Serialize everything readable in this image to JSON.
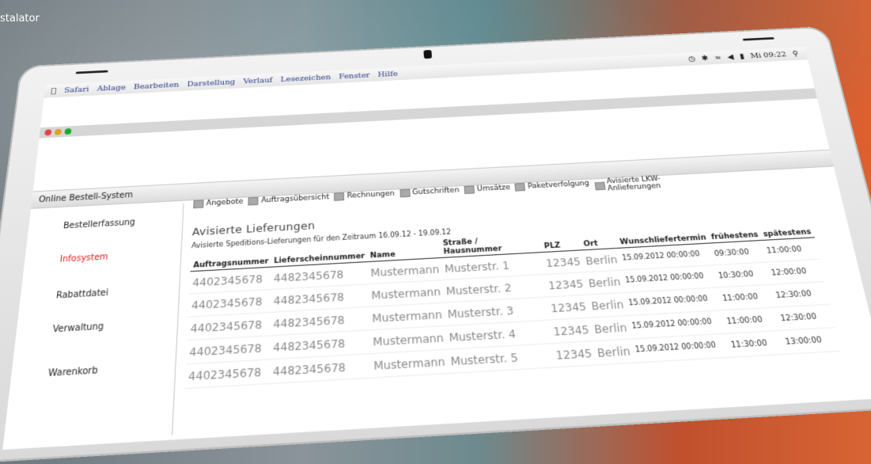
{
  "background": {
    "brand_text": "stalator"
  },
  "menubar": {
    "items": [
      "Safari",
      "Ablage",
      "Bearbeiten",
      "Darstellung",
      "Verlauf",
      "Lesezeichen",
      "Fenster",
      "Hilfe"
    ],
    "clock": "Mi 09:22"
  },
  "app": {
    "title": "Online Bestell-System"
  },
  "sidebar": {
    "items": [
      {
        "label": "Bestellerfassung",
        "active": false
      },
      {
        "label": "Infosystem",
        "active": true
      },
      {
        "label": "Rabattdatei",
        "active": false
      },
      {
        "label": "Verwaltung",
        "active": false
      },
      {
        "label": "Warenkorb",
        "active": false
      }
    ]
  },
  "tabs": [
    "Angebote",
    "Auftragsübersicht",
    "Rechnungen",
    "Gutschriften",
    "Umsätze",
    "Paketverfolgung",
    "Avisierte LKW-Anlieferungen"
  ],
  "main": {
    "heading": "Avisierte Lieferungen",
    "subtitle": "Avisierte Speditions-Lieferungen für den Zeitraum 16.09.12 - 19.09.12"
  },
  "table": {
    "headers": [
      "Auftragsnummer",
      "Lieferscheinnummer",
      "Name",
      "Straße / Hausnummer",
      "PLZ",
      "Ort",
      "Wunschliefertermin",
      "frühestens",
      "spätestens"
    ],
    "rows": [
      {
        "auftrag": "4402345678",
        "lieferschein": "4482345678",
        "name": "Mustermann",
        "strasse": "Musterstr. 1",
        "plz": "12345",
        "ort": "Berlin",
        "termin": "15.09.2012 00:00:00",
        "frueh": "09:30:00",
        "spaet": "11:00:00"
      },
      {
        "auftrag": "4402345678",
        "lieferschein": "4482345678",
        "name": "Mustermann",
        "strasse": "Musterstr. 2",
        "plz": "12345",
        "ort": "Berlin",
        "termin": "15.09.2012 00:00:00",
        "frueh": "10:30:00",
        "spaet": "12:00:00"
      },
      {
        "auftrag": "4402345678",
        "lieferschein": "4482345678",
        "name": "Mustermann",
        "strasse": "Musterstr. 3",
        "plz": "12345",
        "ort": "Berlin",
        "termin": "15.09.2012 00:00:00",
        "frueh": "11:00:00",
        "spaet": "12:30:00"
      },
      {
        "auftrag": "4402345678",
        "lieferschein": "4482345678",
        "name": "Mustermann",
        "strasse": "Musterstr. 4",
        "plz": "12345",
        "ort": "Berlin",
        "termin": "15.09.2012 00:00:00",
        "frueh": "11:00:00",
        "spaet": "12:30:00"
      },
      {
        "auftrag": "4402345678",
        "lieferschein": "4482345678",
        "name": "Mustermann",
        "strasse": "Musterstr. 5",
        "plz": "12345",
        "ort": "Berlin",
        "termin": "15.09.2012 00:00:00",
        "frueh": "11:30:00",
        "spaet": "13:00:00"
      }
    ]
  }
}
